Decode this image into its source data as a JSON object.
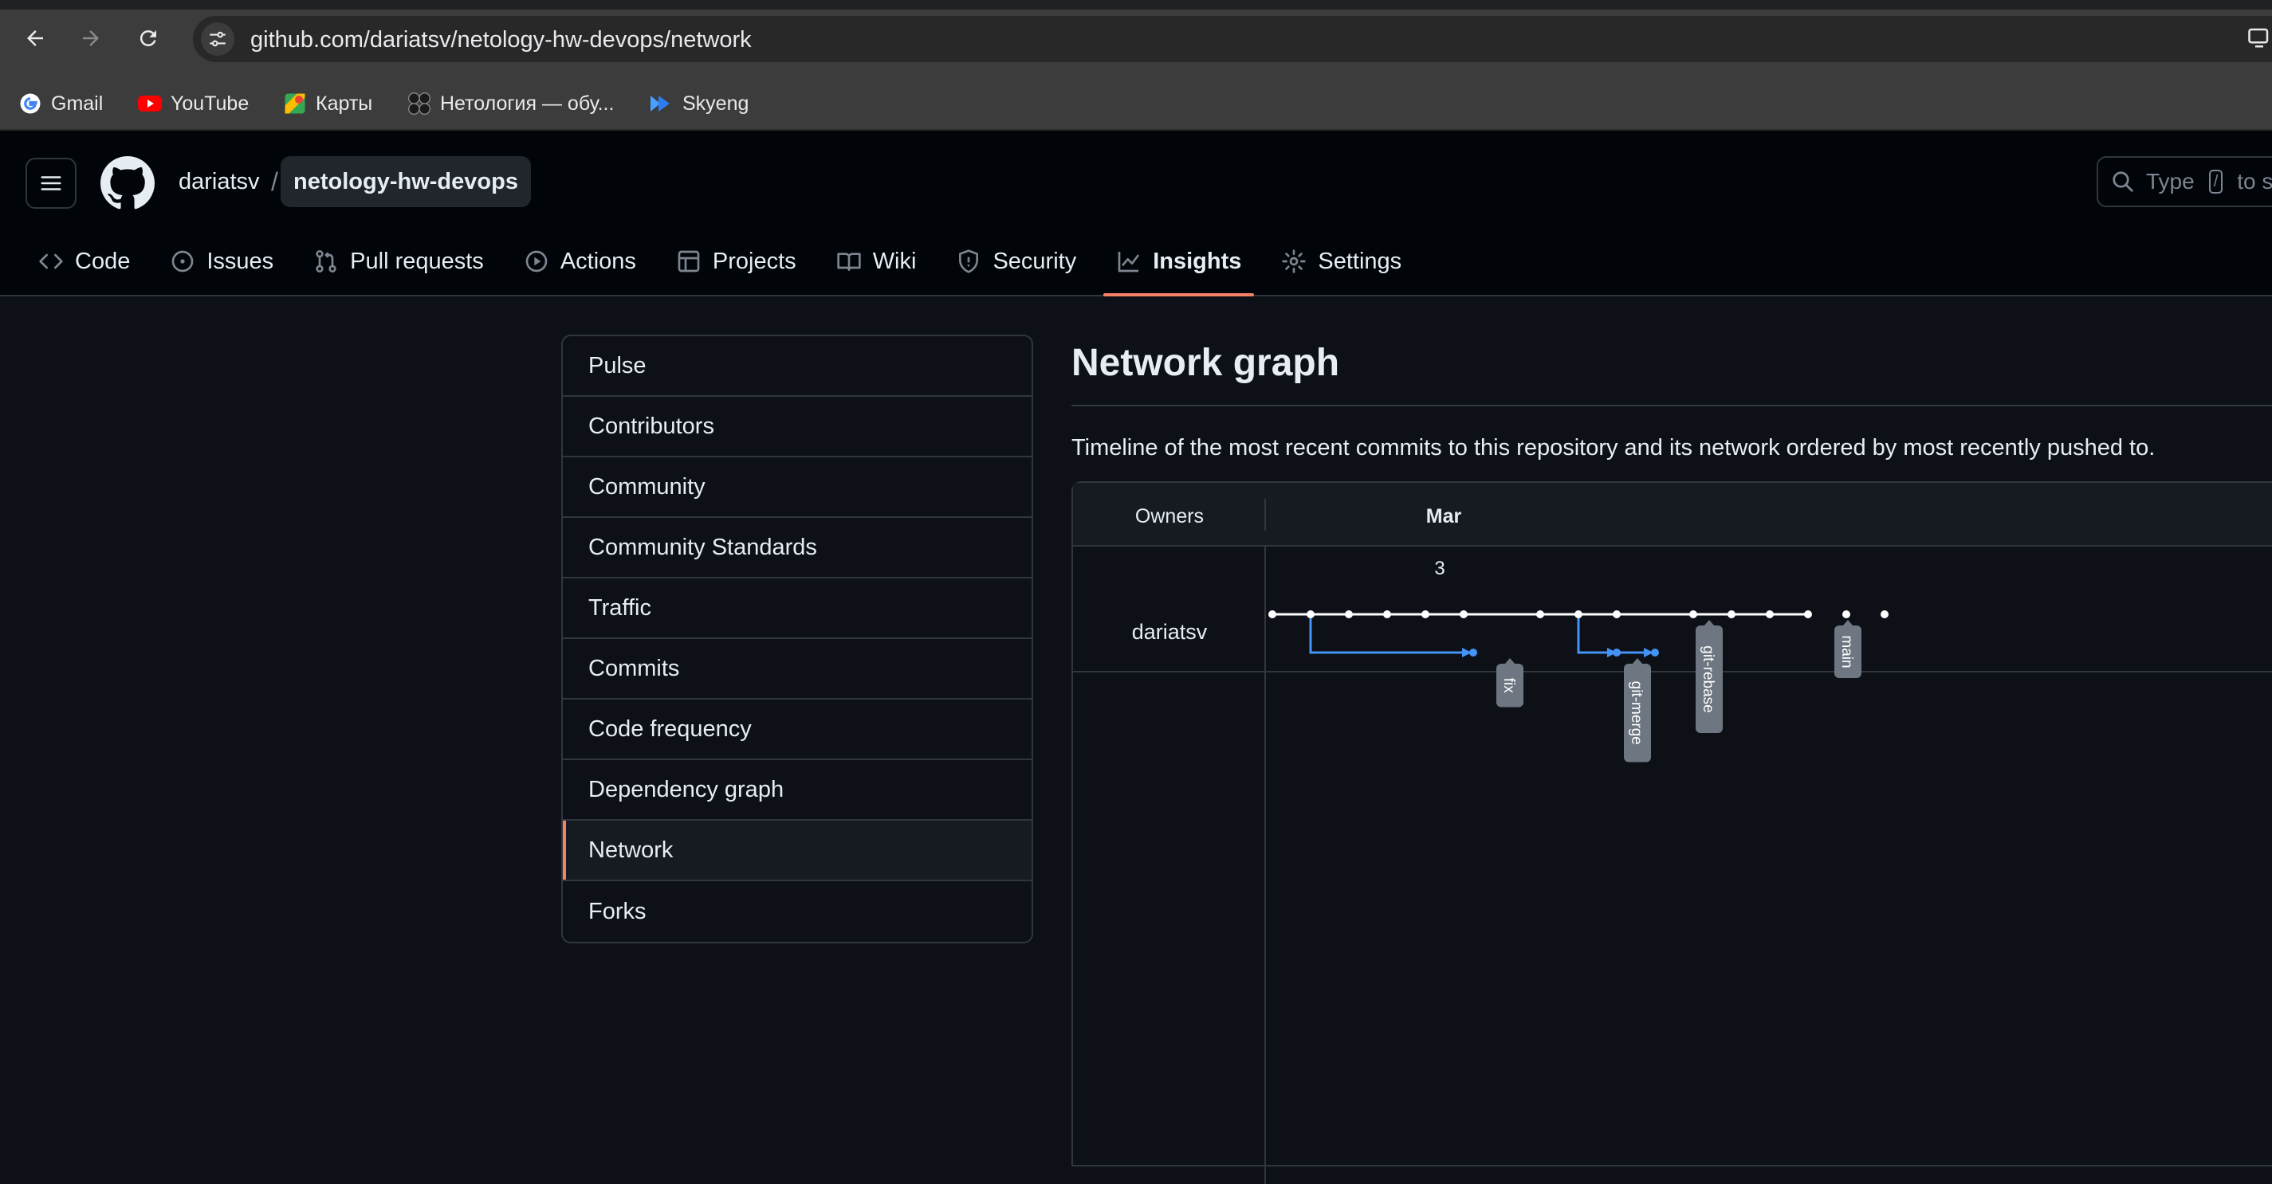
{
  "browser": {
    "url": "github.com/dariatsv/netology-hw-devops/network",
    "bookmarks": [
      {
        "label": "Gmail",
        "icon": "google-icon"
      },
      {
        "label": "YouTube",
        "icon": "youtube-icon"
      },
      {
        "label": "Карты",
        "icon": "maps-icon"
      },
      {
        "label": "Нетология — обу...",
        "icon": "netology-icon"
      },
      {
        "label": "Skyeng",
        "icon": "skyeng-icon"
      }
    ]
  },
  "header": {
    "owner": "dariatsv",
    "separator": "/",
    "repo": "netology-hw-devops",
    "search_prefix": "Type",
    "search_key": "/",
    "search_suffix": "to se"
  },
  "tabs": [
    {
      "label": "Code",
      "icon": "code-icon"
    },
    {
      "label": "Issues",
      "icon": "issue-opened-icon"
    },
    {
      "label": "Pull requests",
      "icon": "pull-request-icon"
    },
    {
      "label": "Actions",
      "icon": "play-icon"
    },
    {
      "label": "Projects",
      "icon": "table-icon"
    },
    {
      "label": "Wiki",
      "icon": "book-icon"
    },
    {
      "label": "Security",
      "icon": "shield-icon"
    },
    {
      "label": "Insights",
      "icon": "graph-icon",
      "active": true
    },
    {
      "label": "Settings",
      "icon": "gear-icon"
    }
  ],
  "insights_menu": [
    {
      "label": "Pulse"
    },
    {
      "label": "Contributors"
    },
    {
      "label": "Community"
    },
    {
      "label": "Community Standards"
    },
    {
      "label": "Traffic"
    },
    {
      "label": "Commits"
    },
    {
      "label": "Code frequency"
    },
    {
      "label": "Dependency graph"
    },
    {
      "label": "Network",
      "selected": true
    },
    {
      "label": "Forks"
    }
  ],
  "main": {
    "title": "Network graph",
    "description": "Timeline of the most recent commits to this repository and its network ordered by most recently pushed to."
  },
  "network": {
    "owners_header": "Owners",
    "month": "Mar",
    "day": "3",
    "owner": "dariatsv",
    "main_commit_count": 15,
    "branches": [
      {
        "name": "fix",
        "from_commit": 2,
        "commits": 1
      },
      {
        "name": "git-merge",
        "from_commit": 9,
        "commits": 2
      },
      {
        "name": "git-rebase",
        "on_main": true
      },
      {
        "name": "main",
        "on_main": true
      }
    ],
    "colors": {
      "main": "#ffffff",
      "branch": "#4493f8",
      "label_bg": "#6e7681"
    }
  }
}
